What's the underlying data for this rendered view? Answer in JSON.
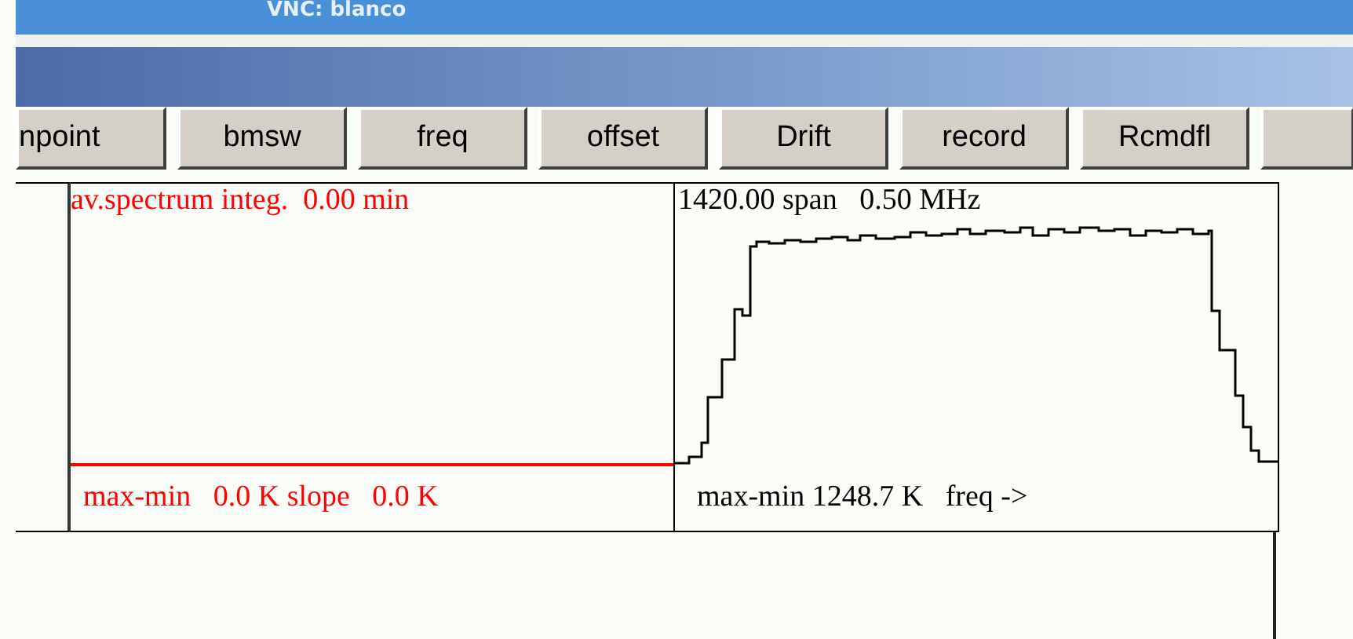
{
  "window": {
    "title": "VNC: blanco"
  },
  "buttons": [
    {
      "label": "npoint"
    },
    {
      "label": "bmsw"
    },
    {
      "label": "freq"
    },
    {
      "label": "offset"
    },
    {
      "label": "Drift"
    },
    {
      "label": "record"
    },
    {
      "label": "Rcmdfl"
    }
  ],
  "integration_panel": {
    "header": "av.spectrum integ.  0.00 min",
    "footer": "max-min   0.0 K slope   0.0 K"
  },
  "spectrum_panel": {
    "header": "1420.00 span   0.50 MHz",
    "footer": "max-min 1248.7 K   freq ->"
  }
}
